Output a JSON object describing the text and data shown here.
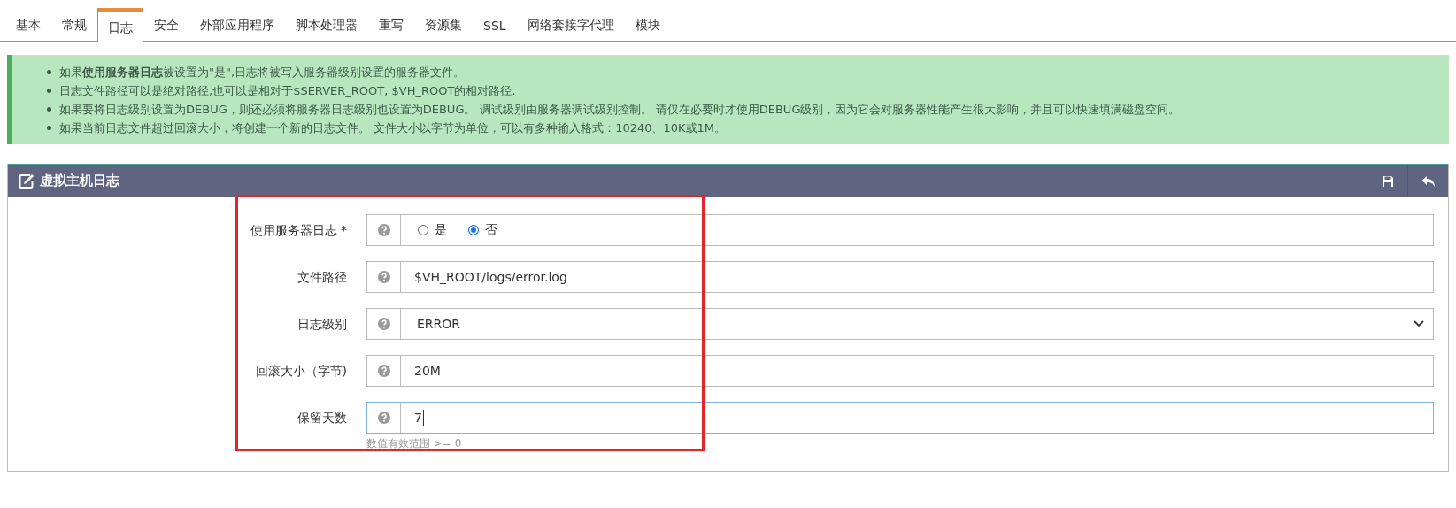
{
  "tabs": [
    {
      "label": "基本",
      "selected": false
    },
    {
      "label": "常规",
      "selected": false
    },
    {
      "label": "日志",
      "selected": true
    },
    {
      "label": "安全",
      "selected": false
    },
    {
      "label": "外部应用程序",
      "selected": false
    },
    {
      "label": "脚本处理器",
      "selected": false
    },
    {
      "label": "重写",
      "selected": false
    },
    {
      "label": "资源集",
      "selected": false
    },
    {
      "label": "SSL",
      "selected": false
    },
    {
      "label": "网络套接字代理",
      "selected": false
    },
    {
      "label": "模块",
      "selected": false
    }
  ],
  "notes": [
    "如果**使用服务器日志**被设置为\"是\",日志将被写入服务器级别设置的服务器文件。",
    "日志文件路径可以是绝对路径,也可以是相对于$SERVER_ROOT, $VH_ROOT的相对路径.",
    "如果要将日志级别设置为DEBUG，则还必须将服务器日志级别也设置为DEBUG。 调试级别由服务器调试级别控制。 请仅在必要时才使用DEBUG级别，因为它会对服务器性能产生很大影响，并且可以快速填满磁盘空间。",
    "如果当前日志文件超过回滚大小，将创建一个新的日志文件。 文件大小以字节为单位，可以有多种输入格式：10240、10K或1M。"
  ],
  "panel": {
    "title": "虚拟主机日志",
    "fields": [
      {
        "kind": "radio",
        "label": "使用服务器日志 *",
        "options": [
          {
            "label": "是",
            "selected": false
          },
          {
            "label": "否",
            "selected": true
          }
        ]
      },
      {
        "kind": "text",
        "label": "文件路径",
        "value": "$VH_ROOT/logs/error.log",
        "focused": false
      },
      {
        "kind": "select",
        "label": "日志级别",
        "value": "ERROR"
      },
      {
        "kind": "text",
        "label": "回滚大小（字节)",
        "value": "20M",
        "focused": false
      },
      {
        "kind": "text",
        "label": "保留天数",
        "value": "7",
        "focused": true,
        "hint": "数值有效范围 >= 0"
      }
    ]
  }
}
